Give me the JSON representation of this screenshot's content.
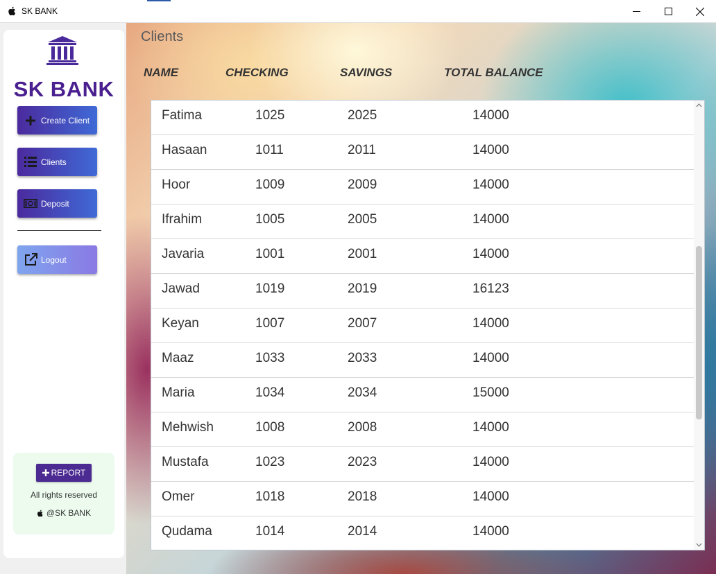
{
  "window": {
    "title": "SK BANK"
  },
  "sidebar": {
    "brand": "SK BANK",
    "nav": [
      {
        "label": "Create Client",
        "icon": "plus-icon"
      },
      {
        "label": "Clients",
        "icon": "list-icon"
      },
      {
        "label": "Deposit",
        "icon": "money-icon"
      },
      {
        "label": "Logout",
        "icon": "external-link-icon"
      }
    ],
    "report_label": "REPORT",
    "rights": "All rights reserved",
    "copyright": "@SK BANK"
  },
  "main": {
    "title": "Clients",
    "columns": [
      "NAME",
      "CHECKING",
      "SAVINGS",
      "TOTAL BALANCE"
    ],
    "rows": [
      {
        "name": "Fatima",
        "checking": "1025",
        "savings": "2025",
        "total": "14000"
      },
      {
        "name": "Hasaan",
        "checking": "1011",
        "savings": "2011",
        "total": "14000"
      },
      {
        "name": "Hoor",
        "checking": "1009",
        "savings": "2009",
        "total": "14000"
      },
      {
        "name": "Ifrahim",
        "checking": "1005",
        "savings": "2005",
        "total": "14000"
      },
      {
        "name": "Javaria",
        "checking": "1001",
        "savings": "2001",
        "total": "14000"
      },
      {
        "name": "Jawad",
        "checking": "1019",
        "savings": "2019",
        "total": "16123"
      },
      {
        "name": "Keyan",
        "checking": "1007",
        "savings": "2007",
        "total": "14000"
      },
      {
        "name": "Maaz",
        "checking": "1033",
        "savings": "2033",
        "total": "14000"
      },
      {
        "name": "Maria",
        "checking": "1034",
        "savings": "2034",
        "total": "15000"
      },
      {
        "name": "Mehwish",
        "checking": "1008",
        "savings": "2008",
        "total": "14000"
      },
      {
        "name": "Mustafa",
        "checking": "1023",
        "savings": "2023",
        "total": "14000"
      },
      {
        "name": "Omer",
        "checking": "1018",
        "savings": "2018",
        "total": "14000"
      },
      {
        "name": "Qudama",
        "checking": "1014",
        "savings": "2014",
        "total": "14000"
      }
    ]
  },
  "colors": {
    "brand_purple": "#4a1f8f",
    "nav_gradient_start": "#4b2a9e",
    "nav_gradient_end": "#3f6ad6",
    "report_bg": "#ecfbee"
  }
}
